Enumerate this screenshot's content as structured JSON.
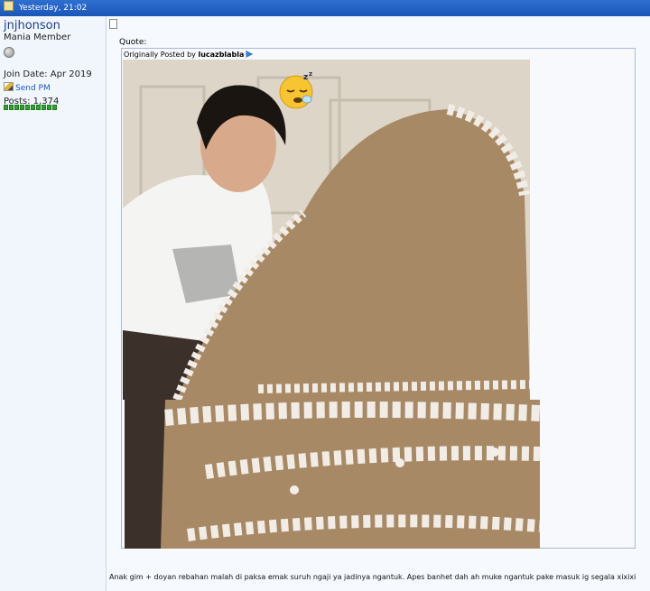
{
  "header": {
    "timestamp": "Yesterday, 21:02",
    "icon": "post-icon"
  },
  "user": {
    "username": "jnjhonson",
    "title": "Mania Member",
    "status": "offline-status-icon",
    "join_date": "Join Date: Apr 2019",
    "send_pm": "Send PM",
    "posts": "Posts: 1,374",
    "reputation_pips": 10
  },
  "post": {
    "quote_label": "Quote:",
    "quote": {
      "prefix": "Originally Posted by ",
      "author": "lucazblabla"
    },
    "body": "Anak gim + doyan rebahan malah di paksa emak suruh ngaji ya jadinya ngantuk. Apes banhet dah ah muke ngantuk pake masuk ig segala xixixi"
  },
  "colors": {
    "header": "#1a56b8",
    "link": "#1c3f86",
    "sidebar": "#f1f6fd",
    "reputation": "#2ea52e"
  }
}
